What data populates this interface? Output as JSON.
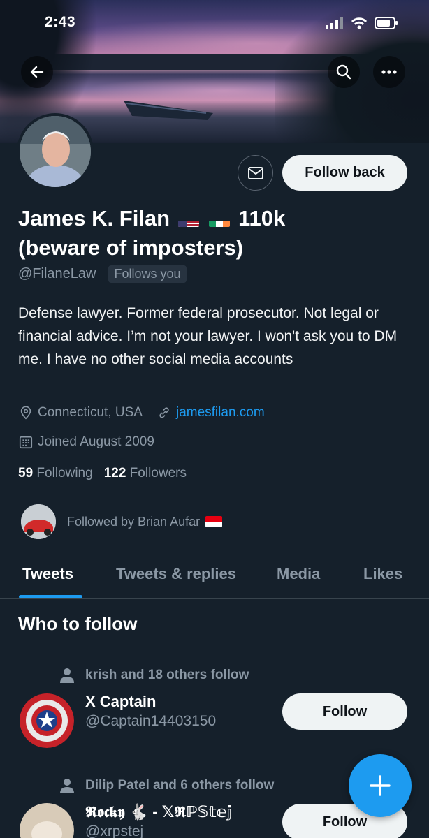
{
  "status_bar": {
    "time": "2:43"
  },
  "profile": {
    "name_part1": "James K. Filan",
    "name_part2": "110k",
    "name_line2": "(beware of imposters)",
    "handle": "@FilaneLaw",
    "follows_you": "Follows you",
    "bio": "Defense lawyer. Former federal prosecutor. Not legal or financial advice. I’m not your lawyer. I won't ask you to DM me. I have no other social media accounts",
    "location": "Connecticut, USA",
    "website": "jamesfilan.com",
    "joined": "Joined August 2009",
    "following_count": "59",
    "following_label": "Following",
    "followers_count": "122",
    "followers_label": "Followers",
    "followed_by": "Followed by Brian Aufar",
    "follow_back_label": "Follow back"
  },
  "tabs": [
    {
      "label": "Tweets",
      "active": true
    },
    {
      "label": "Tweets & replies",
      "active": false
    },
    {
      "label": "Media",
      "active": false
    },
    {
      "label": "Likes",
      "active": false
    }
  ],
  "who_to_follow": {
    "title": "Who to follow",
    "suggestions": [
      {
        "context": "krish and 18 others follow",
        "name": "X Captain",
        "handle": "@Captain14403150",
        "button": "Follow"
      },
      {
        "context": "Dilip Patel and 6 others follow",
        "name": "𝕽𝖔𝖈𝖐𝖞 🐇 - 𝕏𝕽ℙ𝕊𝕥𝕖𝕛",
        "handle": "@xrpstej",
        "button": "Follow"
      }
    ]
  },
  "colors": {
    "background": "#15202b",
    "accent": "#1d9bf0",
    "muted": "#8b98a5"
  }
}
